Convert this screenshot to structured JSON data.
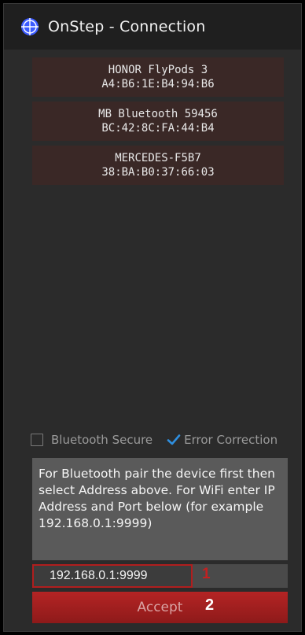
{
  "window": {
    "title": "OnStep - Connection",
    "icon": "crosshair-circle-icon",
    "accent": "#3b5bff"
  },
  "devices": [
    {
      "name": "HONOR FlyPods 3",
      "address": "A4:B6:1E:B4:94:B6"
    },
    {
      "name": "MB Bluetooth 59456",
      "address": "BC:42:8C:FA:44:B4"
    },
    {
      "name": "MERCEDES-F5B7",
      "address": "38:BA:B0:37:66:03"
    }
  ],
  "options": {
    "bluetooth_secure_label": "Bluetooth Secure",
    "bluetooth_secure_checked": false,
    "error_correction_label": "Error Correction",
    "error_correction_checked": true,
    "check_color": "#2f8fdf"
  },
  "info": {
    "text": "For Bluetooth pair the device first then select Address above. For WiFi enter IP Address and Port below (for example 192.168.0.1:9999)"
  },
  "ip": {
    "value": "192.168.0.1:9999",
    "annotation": "1"
  },
  "accept": {
    "label": "Accept",
    "annotation": "2",
    "color": "#b42424"
  }
}
